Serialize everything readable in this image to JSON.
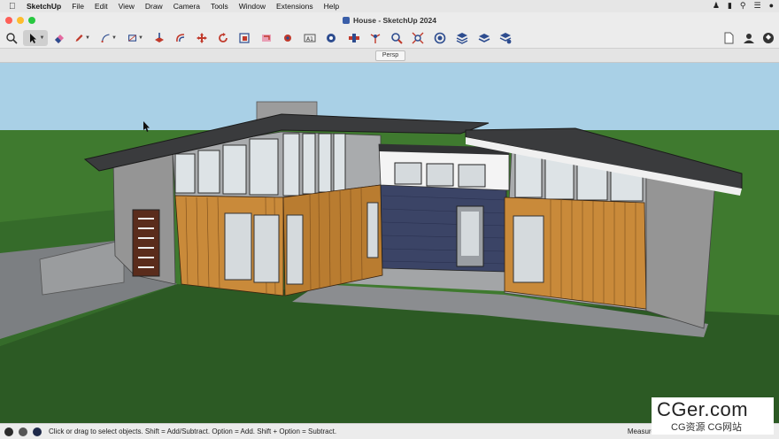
{
  "menubar": {
    "apple": "",
    "app_name": "SketchUp",
    "items": [
      "File",
      "Edit",
      "View",
      "Draw",
      "Camera",
      "Tools",
      "Window",
      "Extensions",
      "Help"
    ]
  },
  "window": {
    "title": "House - SketchUp 2024"
  },
  "toolbar": {
    "tools": [
      "search-icon",
      "select-icon",
      "eraser-icon",
      "pencil-icon",
      "arc-icon",
      "rectangle-icon",
      "push-pull-icon",
      "offset-icon",
      "move-icon",
      "rotate-icon",
      "scale-icon",
      "follow-me-icon",
      "text-icon",
      "paint-icon",
      "tape-measure-icon",
      "section-icon",
      "zoom-icon",
      "zoom-extents-icon",
      "orbit-icon",
      "layers-icon",
      "tags-icon",
      "styles-icon"
    ],
    "right_tools": [
      "new-document-icon",
      "user-icon",
      "instructor-icon"
    ]
  },
  "scene_tab": {
    "label": "Persp"
  },
  "status": {
    "text": "Click or drag to select objects. Shift = Add/Subtract. Option = Add. Shift + Option = Subtract.",
    "measurements_label": "Measure"
  },
  "watermark": {
    "line1": "CGer.com",
    "line2": "CG资源  CG网站"
  },
  "colors": {
    "sky": "#a9d0e6",
    "grass": "#2c5a24",
    "wood": "#c98a3a",
    "siding": "#3b4466",
    "concrete": "#9a9a9a",
    "roof": "#3a3b3d"
  }
}
